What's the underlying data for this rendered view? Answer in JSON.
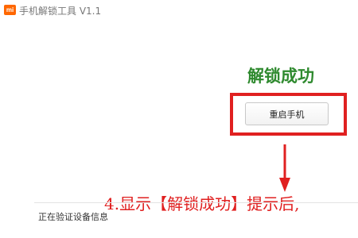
{
  "app": {
    "logo_text": "mi",
    "title": "手机解锁工具  V1.1"
  },
  "main": {
    "success_text": "解锁成功",
    "restart_button_label": "重启手机",
    "status_text": "正在验证设备信息"
  },
  "annotation": {
    "caption": "4.显示【解锁成功】提示后,",
    "highlight_color": "#e02020"
  },
  "colors": {
    "brand": "#ff6700",
    "success": "#2f8a2f"
  }
}
